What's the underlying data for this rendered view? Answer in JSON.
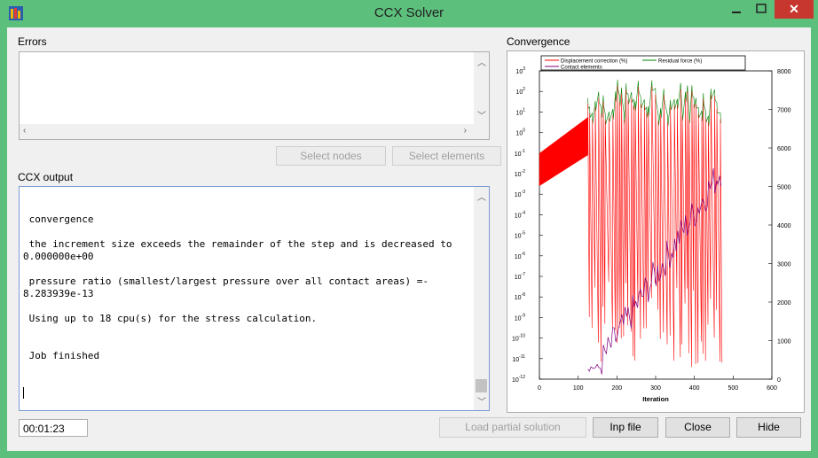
{
  "window": {
    "title": "CCX Solver",
    "accent_color": "#5cbf7c",
    "close_symbol": "✕",
    "minimize_symbol": "—",
    "maximize_symbol": "□"
  },
  "errors": {
    "label": "Errors"
  },
  "buttons": {
    "select_nodes": "Select nodes",
    "select_elements": "Select elements",
    "load_partial": "Load partial solution",
    "inp_file": "Inp file",
    "close": "Close",
    "hide": "Hide"
  },
  "output": {
    "label": "CCX output",
    "lines": [
      "",
      " convergence",
      "",
      " the increment size exceeds the remainder of the step and is decreased to",
      "0.000000e+00",
      "",
      " pressure ratio (smallest/largest pressure over all contact areas) =-",
      "8.283939e-13",
      "",
      " Using up to 18 cpu(s) for the stress calculation.",
      "",
      "",
      " Job finished"
    ]
  },
  "timer": "00:01:23",
  "chart_data": {
    "title": "Convergence",
    "type": "line",
    "xlabel": "Iteration",
    "xlim": [
      0,
      600
    ],
    "x_ticks": [
      0,
      100,
      200,
      300,
      400,
      500,
      600
    ],
    "y_left_scale": "log",
    "y_left_ticks_exp": [
      3,
      2,
      1,
      0,
      -1,
      -2,
      -3,
      -4,
      -5,
      -6,
      -7,
      -8,
      -9,
      -10,
      -11,
      -12
    ],
    "y_left_base": "10",
    "y_right_lim": [
      0,
      8000
    ],
    "y_right_ticks": [
      0,
      1000,
      2000,
      3000,
      4000,
      5000,
      6000,
      7000,
      8000
    ],
    "legend_placement": "top",
    "series": [
      {
        "name": "Displacement correction (%)",
        "color": "#ff0000",
        "axis": "left",
        "x_range": [
          0,
          470
        ]
      },
      {
        "name": "Residual force (%)",
        "color": "#008000",
        "axis": "left",
        "x_range": [
          0,
          470
        ]
      },
      {
        "name": "Contact elements",
        "color": "#800080",
        "axis": "right",
        "x_range": [
          125,
          470
        ]
      }
    ]
  }
}
